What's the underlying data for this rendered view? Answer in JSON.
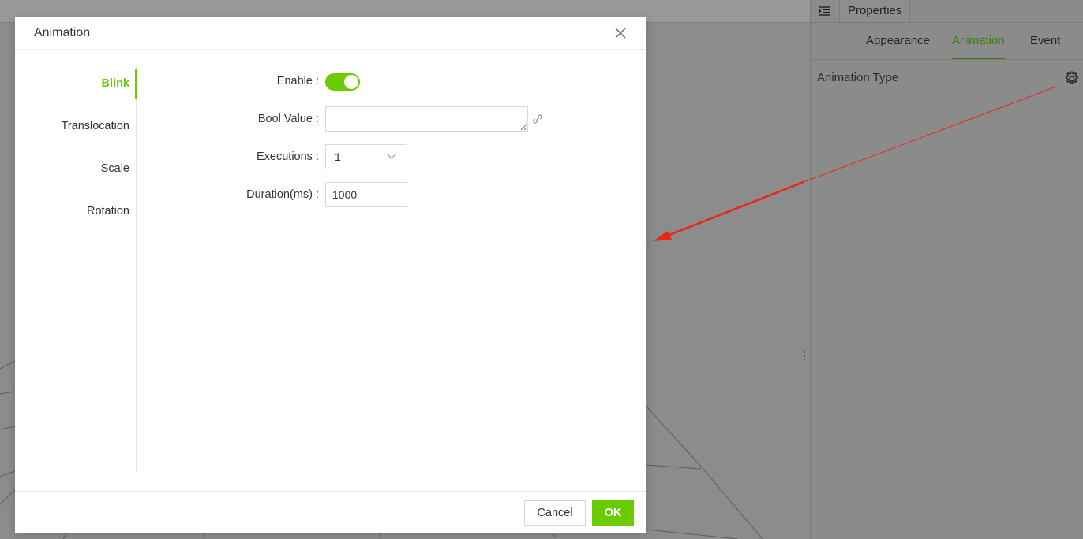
{
  "properties_panel": {
    "title": "Properties",
    "menu_icon": "outline-list-icon",
    "tabs": [
      {
        "label": "Appearance",
        "active": false
      },
      {
        "label": "Animation",
        "active": true
      },
      {
        "label": "Event",
        "active": false
      }
    ],
    "animation_type_label": "Animation Type",
    "settings_icon": "gear-icon"
  },
  "collapse_handle_icon": "vertical-ellipsis-icon",
  "modal": {
    "title": "Animation",
    "close_icon": "close-icon",
    "nav_items": [
      {
        "label": "Blink",
        "active": true
      },
      {
        "label": "Translocation",
        "active": false
      },
      {
        "label": "Scale",
        "active": false
      },
      {
        "label": "Rotation",
        "active": false
      }
    ],
    "form": {
      "enable_label": "Enable :",
      "enable_value": true,
      "bool_value_label": "Bool Value :",
      "bool_value": "",
      "bool_link_icon": "link-icon",
      "executions_label": "Executions :",
      "executions_value": "1",
      "duration_label": "Duration(ms) :",
      "duration_value": "1000"
    },
    "footer": {
      "cancel_label": "Cancel",
      "ok_label": "OK"
    }
  },
  "colors": {
    "accent_green": "#6ccb00",
    "panel_active_tab": "#3e7a06",
    "annotation_arrow": "#e8261a",
    "overlay_gray": "#8c8c8c"
  }
}
